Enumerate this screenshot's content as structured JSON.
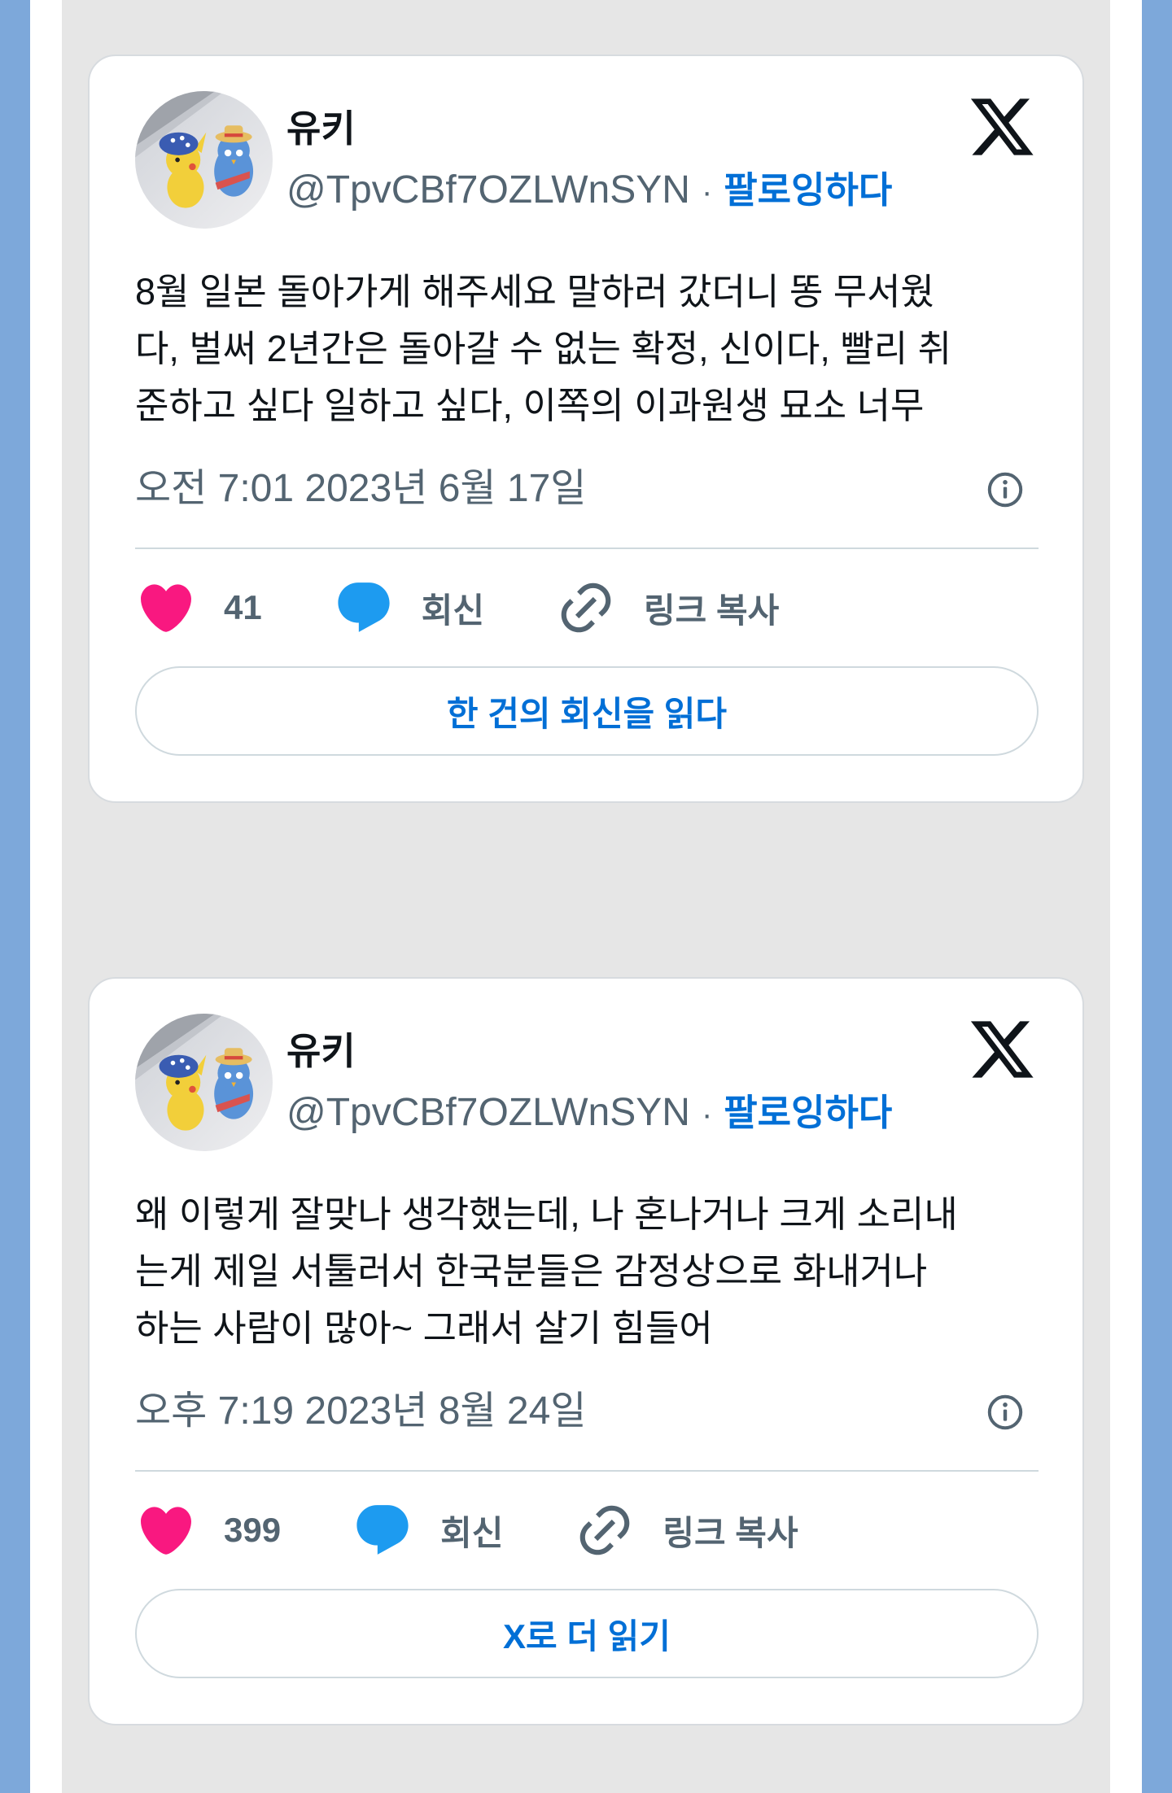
{
  "colors": {
    "page_bg": "#e6e6e6",
    "side_band": "#7da8da",
    "strip": "#ffffff",
    "card_bg": "#ffffff",
    "text": "#0f1419",
    "muted": "#536471",
    "accent": "#006fd6",
    "like": "#f91880",
    "reply": "#1d9bf0",
    "divider": "#cfd9de"
  },
  "icons": {
    "logo": "x-logo-icon",
    "info": "info-icon",
    "like": "heart-icon",
    "reply": "speech-bubble-icon",
    "copy_link": "link-icon"
  },
  "tweets": [
    {
      "author": {
        "name": "유키",
        "handle": "@TpvCBf7OZLWnSYN",
        "separator": "·",
        "follow_label": "팔로잉하다"
      },
      "text_lines": [
        "8월 일본 돌아가게 해주세요 말하러 갔더니 똥 무서웠",
        "다, 벌써 2년간은 돌아갈 수 없는 확정, 신이다, 빨리 취",
        "준하고 싶다 일하고 싶다, 이쪽의 이과원생 묘소 너무"
      ],
      "timestamp": "오전 7:01 2023년 6월 17일",
      "actions": {
        "like_count": "41",
        "reply_label": "회신",
        "copy_link_label": "링크 복사"
      },
      "footer_button_label": "한 건의 회신을 읽다"
    },
    {
      "author": {
        "name": "유키",
        "handle": "@TpvCBf7OZLWnSYN",
        "separator": "·",
        "follow_label": "팔로잉하다"
      },
      "text_lines": [
        "왜 이렇게 잘맞나 생각했는데, 나 혼나거나 크게 소리내",
        "는게 제일 서툴러서 한국분들은 감정상으로 화내거나",
        "하는 사람이 많아~ 그래서 살기 힘들어"
      ],
      "timestamp": "오후 7:19 2023년 8월 24일",
      "actions": {
        "like_count": "399",
        "reply_label": "회신",
        "copy_link_label": "링크 복사"
      },
      "footer_button_label": "X로 더 읽기"
    }
  ]
}
